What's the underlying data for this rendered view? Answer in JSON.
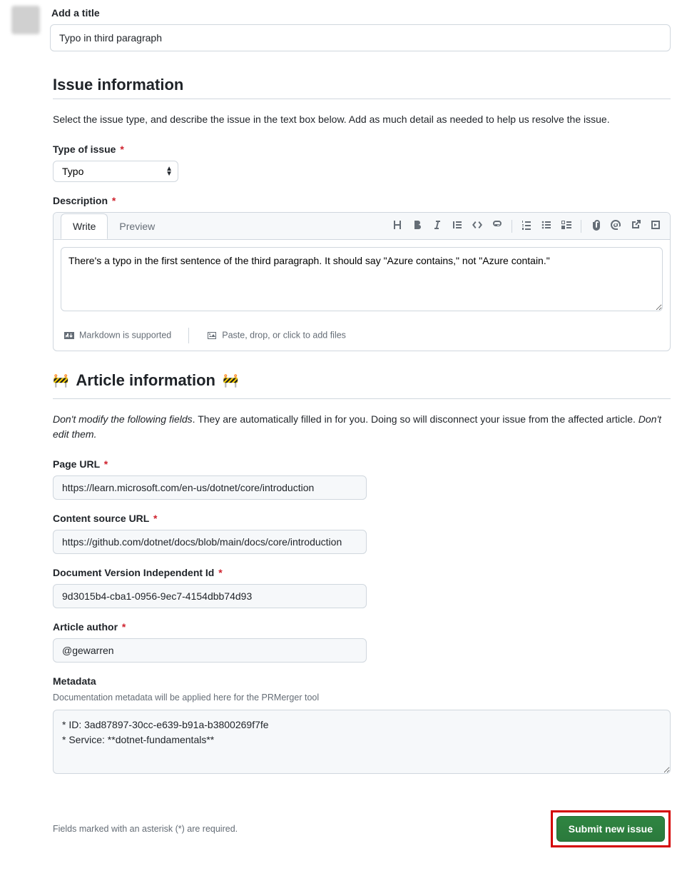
{
  "title_section": {
    "label": "Add a title",
    "value": "Typo in third paragraph"
  },
  "issue_info": {
    "heading": "Issue information",
    "intro": "Select the issue type, and describe the issue in the text box below. Add as much detail as needed to help us resolve the issue.",
    "type_label": "Type of issue",
    "type_value": "Typo",
    "description_label": "Description",
    "tabs": {
      "write": "Write",
      "preview": "Preview"
    },
    "description_value": "There's a typo in the first sentence of the third paragraph. It should say \"Azure contains,\" not \"Azure contain.\"",
    "markdown_note": "Markdown is supported",
    "attach_note": "Paste, drop, or click to add files"
  },
  "article_info": {
    "heading": "Article information",
    "warning_italic_1": "Don't modify the following fields",
    "warning_rest_1": ". They are automatically filled in for you. Doing so will disconnect your issue from the affected article. ",
    "warning_italic_2": "Don't edit them.",
    "page_url_label": "Page URL",
    "page_url_value": "https://learn.microsoft.com/en-us/dotnet/core/introduction",
    "content_source_label": "Content source URL",
    "content_source_value": "https://github.com/dotnet/docs/blob/main/docs/core/introduction",
    "doc_version_label": "Document Version Independent Id",
    "doc_version_value": "9d3015b4-cba1-0956-9ec7-4154dbb74d93",
    "author_label": "Article author",
    "author_value": "@gewarren",
    "metadata_label": "Metadata",
    "metadata_help": "Documentation metadata will be applied here for the PRMerger tool",
    "metadata_value": "* ID: 3ad87897-30cc-e639-b91a-b3800269f7fe\n* Service: **dotnet-fundamentals**"
  },
  "footer": {
    "note": "Fields marked with an asterisk (*) are required.",
    "submit_label": "Submit new issue"
  }
}
